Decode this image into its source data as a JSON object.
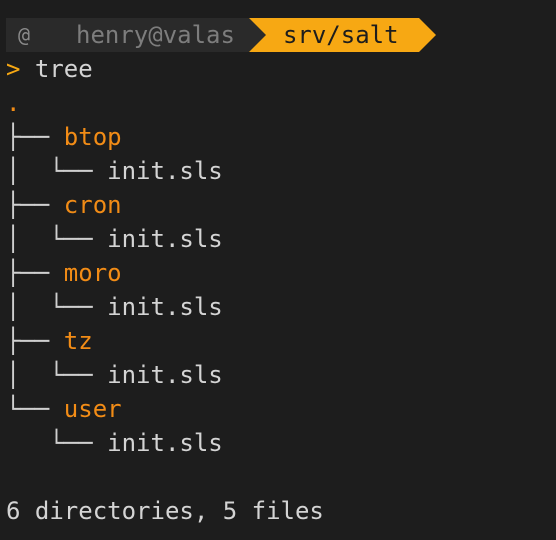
{
  "prompt": {
    "os_icon": "debian-swirl-icon",
    "user_host": "henry@valas",
    "path": "srv/salt",
    "symbol": ">",
    "command": "tree",
    "colors": {
      "path_bg": "#f7a813",
      "user_bg": "#2a2a2a",
      "directory": "#f28c16"
    }
  },
  "tree": {
    "root": ".",
    "entries": [
      {
        "branch": "├── ",
        "name": "btop",
        "child_branch": "│  └── ",
        "child": "init.sls"
      },
      {
        "branch": "├── ",
        "name": "cron",
        "child_branch": "│  └── ",
        "child": "init.sls"
      },
      {
        "branch": "├── ",
        "name": "moro",
        "child_branch": "│  └── ",
        "child": "init.sls"
      },
      {
        "branch": "├── ",
        "name": "tz",
        "child_branch": "│  └── ",
        "child": "init.sls"
      },
      {
        "branch": "└── ",
        "name": "user",
        "child_branch": "   └── ",
        "child": "init.sls"
      }
    ],
    "summary": "6 directories, 5 files"
  }
}
